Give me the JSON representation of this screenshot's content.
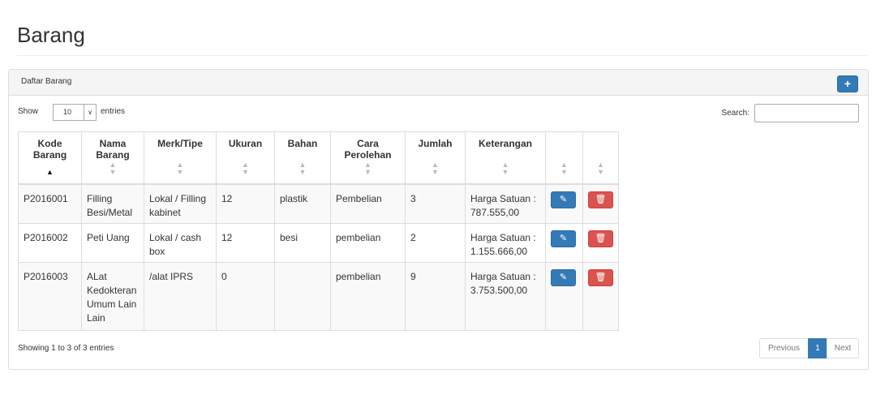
{
  "page": {
    "title": "Barang"
  },
  "panel": {
    "heading": "Daftar Barang",
    "add_icon": "plus-icon"
  },
  "length": {
    "prefix": "Show",
    "value": "10",
    "suffix": "entries"
  },
  "search": {
    "label": "Search:",
    "value": ""
  },
  "table": {
    "columns": [
      "Kode Barang",
      "Nama Barang",
      "Merk/Tipe",
      "Ukuran",
      "Bahan",
      "Cara Perolehan",
      "Jumlah",
      "Keterangan",
      "",
      ""
    ],
    "sorted_column": "Kode Barang",
    "rows": [
      {
        "kode": "P2016001",
        "nama": "Filling Besi/Metal",
        "merk": "Lokal / Filling kabinet",
        "ukuran": "12",
        "bahan": "plastik",
        "cara": "Pembelian",
        "jumlah": "3",
        "keterangan": "Harga Satuan : 787.555,00"
      },
      {
        "kode": "P2016002",
        "nama": "Peti Uang",
        "merk": "Lokal / cash box",
        "ukuran": "12",
        "bahan": "besi",
        "cara": "pembelian",
        "jumlah": "2",
        "keterangan": "Harga Satuan : 1.155.666,00"
      },
      {
        "kode": "P2016003",
        "nama": "ALat Kedokteran Umum Lain Lain",
        "merk": "/alat IPRS",
        "ukuran": "0",
        "bahan": "",
        "cara": "pembelian",
        "jumlah": "9",
        "keterangan": "Harga Satuan : 3.753.500,00"
      }
    ],
    "edit_icon": "edit-icon",
    "delete_icon": "trash-icon"
  },
  "info": "Showing 1 to 3 of 3 entries",
  "pagination": {
    "previous": "Previous",
    "current": "1",
    "next": "Next"
  },
  "colors": {
    "primary": "#337ab7",
    "danger": "#d9534f"
  }
}
